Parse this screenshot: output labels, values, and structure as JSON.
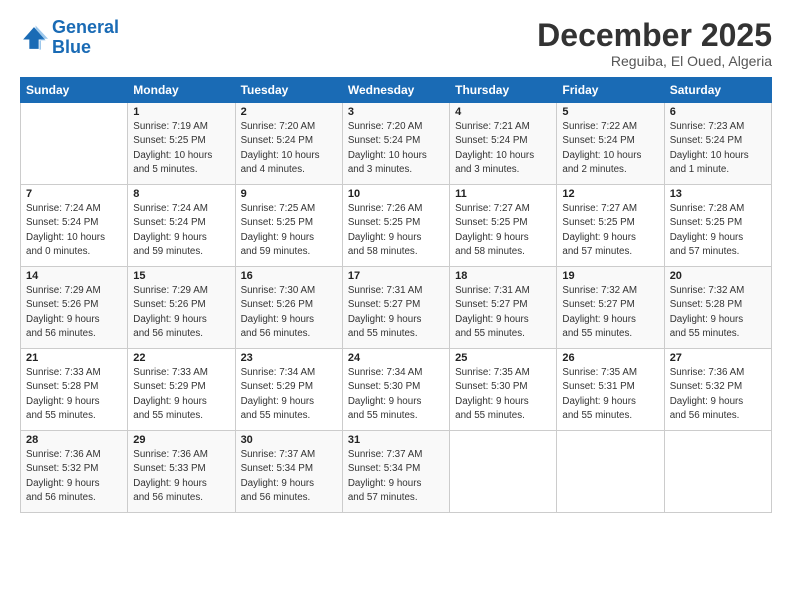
{
  "logo": {
    "line1": "General",
    "line2": "Blue"
  },
  "title": "December 2025",
  "subtitle": "Reguiba, El Oued, Algeria",
  "days_header": [
    "Sunday",
    "Monday",
    "Tuesday",
    "Wednesday",
    "Thursday",
    "Friday",
    "Saturday"
  ],
  "weeks": [
    [
      {
        "num": "",
        "info": ""
      },
      {
        "num": "1",
        "info": "Sunrise: 7:19 AM\nSunset: 5:25 PM\nDaylight: 10 hours\nand 5 minutes."
      },
      {
        "num": "2",
        "info": "Sunrise: 7:20 AM\nSunset: 5:24 PM\nDaylight: 10 hours\nand 4 minutes."
      },
      {
        "num": "3",
        "info": "Sunrise: 7:20 AM\nSunset: 5:24 PM\nDaylight: 10 hours\nand 3 minutes."
      },
      {
        "num": "4",
        "info": "Sunrise: 7:21 AM\nSunset: 5:24 PM\nDaylight: 10 hours\nand 3 minutes."
      },
      {
        "num": "5",
        "info": "Sunrise: 7:22 AM\nSunset: 5:24 PM\nDaylight: 10 hours\nand 2 minutes."
      },
      {
        "num": "6",
        "info": "Sunrise: 7:23 AM\nSunset: 5:24 PM\nDaylight: 10 hours\nand 1 minute."
      }
    ],
    [
      {
        "num": "7",
        "info": "Sunrise: 7:24 AM\nSunset: 5:24 PM\nDaylight: 10 hours\nand 0 minutes."
      },
      {
        "num": "8",
        "info": "Sunrise: 7:24 AM\nSunset: 5:24 PM\nDaylight: 9 hours\nand 59 minutes."
      },
      {
        "num": "9",
        "info": "Sunrise: 7:25 AM\nSunset: 5:25 PM\nDaylight: 9 hours\nand 59 minutes."
      },
      {
        "num": "10",
        "info": "Sunrise: 7:26 AM\nSunset: 5:25 PM\nDaylight: 9 hours\nand 58 minutes."
      },
      {
        "num": "11",
        "info": "Sunrise: 7:27 AM\nSunset: 5:25 PM\nDaylight: 9 hours\nand 58 minutes."
      },
      {
        "num": "12",
        "info": "Sunrise: 7:27 AM\nSunset: 5:25 PM\nDaylight: 9 hours\nand 57 minutes."
      },
      {
        "num": "13",
        "info": "Sunrise: 7:28 AM\nSunset: 5:25 PM\nDaylight: 9 hours\nand 57 minutes."
      }
    ],
    [
      {
        "num": "14",
        "info": "Sunrise: 7:29 AM\nSunset: 5:26 PM\nDaylight: 9 hours\nand 56 minutes."
      },
      {
        "num": "15",
        "info": "Sunrise: 7:29 AM\nSunset: 5:26 PM\nDaylight: 9 hours\nand 56 minutes."
      },
      {
        "num": "16",
        "info": "Sunrise: 7:30 AM\nSunset: 5:26 PM\nDaylight: 9 hours\nand 56 minutes."
      },
      {
        "num": "17",
        "info": "Sunrise: 7:31 AM\nSunset: 5:27 PM\nDaylight: 9 hours\nand 55 minutes."
      },
      {
        "num": "18",
        "info": "Sunrise: 7:31 AM\nSunset: 5:27 PM\nDaylight: 9 hours\nand 55 minutes."
      },
      {
        "num": "19",
        "info": "Sunrise: 7:32 AM\nSunset: 5:27 PM\nDaylight: 9 hours\nand 55 minutes."
      },
      {
        "num": "20",
        "info": "Sunrise: 7:32 AM\nSunset: 5:28 PM\nDaylight: 9 hours\nand 55 minutes."
      }
    ],
    [
      {
        "num": "21",
        "info": "Sunrise: 7:33 AM\nSunset: 5:28 PM\nDaylight: 9 hours\nand 55 minutes."
      },
      {
        "num": "22",
        "info": "Sunrise: 7:33 AM\nSunset: 5:29 PM\nDaylight: 9 hours\nand 55 minutes."
      },
      {
        "num": "23",
        "info": "Sunrise: 7:34 AM\nSunset: 5:29 PM\nDaylight: 9 hours\nand 55 minutes."
      },
      {
        "num": "24",
        "info": "Sunrise: 7:34 AM\nSunset: 5:30 PM\nDaylight: 9 hours\nand 55 minutes."
      },
      {
        "num": "25",
        "info": "Sunrise: 7:35 AM\nSunset: 5:30 PM\nDaylight: 9 hours\nand 55 minutes."
      },
      {
        "num": "26",
        "info": "Sunrise: 7:35 AM\nSunset: 5:31 PM\nDaylight: 9 hours\nand 55 minutes."
      },
      {
        "num": "27",
        "info": "Sunrise: 7:36 AM\nSunset: 5:32 PM\nDaylight: 9 hours\nand 56 minutes."
      }
    ],
    [
      {
        "num": "28",
        "info": "Sunrise: 7:36 AM\nSunset: 5:32 PM\nDaylight: 9 hours\nand 56 minutes."
      },
      {
        "num": "29",
        "info": "Sunrise: 7:36 AM\nSunset: 5:33 PM\nDaylight: 9 hours\nand 56 minutes."
      },
      {
        "num": "30",
        "info": "Sunrise: 7:37 AM\nSunset: 5:34 PM\nDaylight: 9 hours\nand 56 minutes."
      },
      {
        "num": "31",
        "info": "Sunrise: 7:37 AM\nSunset: 5:34 PM\nDaylight: 9 hours\nand 57 minutes."
      },
      {
        "num": "",
        "info": ""
      },
      {
        "num": "",
        "info": ""
      },
      {
        "num": "",
        "info": ""
      }
    ]
  ]
}
